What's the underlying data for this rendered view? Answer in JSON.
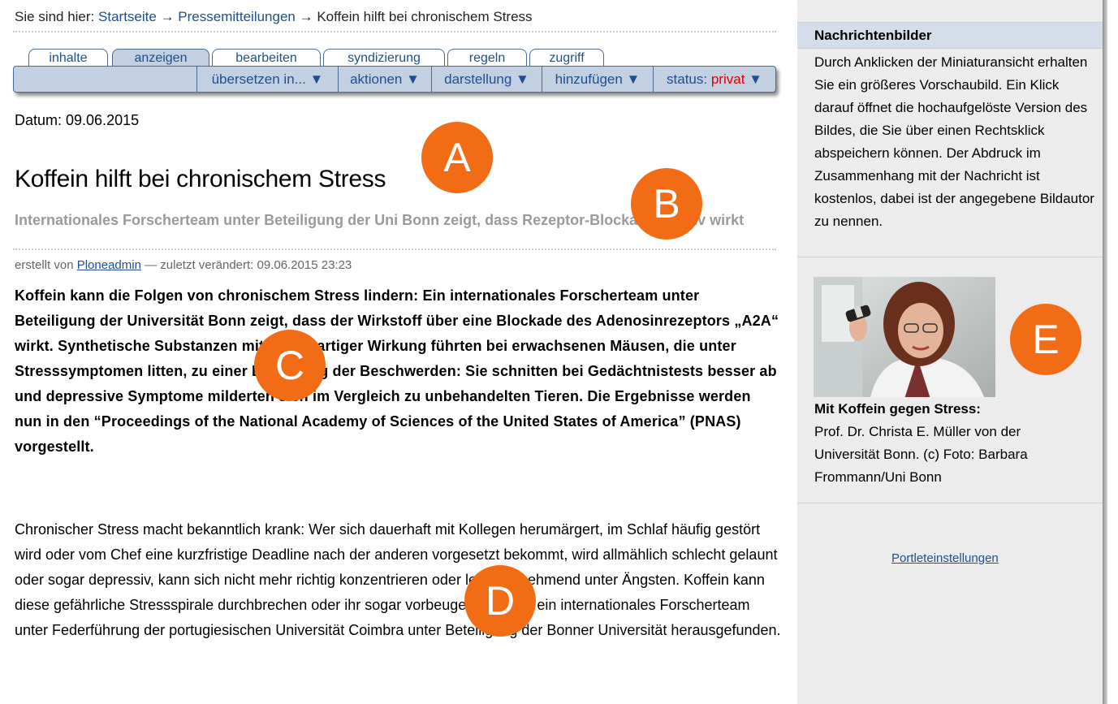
{
  "breadcrumb": {
    "prefix": "Sie sind hier:",
    "items": [
      "Startseite",
      "Pressemitteilungen",
      "Koffein hilft bei chronischem Stress"
    ],
    "separator": "→"
  },
  "tabs": [
    "inhalte",
    "anzeigen",
    "bearbeiten",
    "syndizierung",
    "regeln",
    "zugriff"
  ],
  "active_tab": "anzeigen",
  "actions": {
    "translate": "übersetzen in... ▼",
    "actions": "aktionen ▼",
    "display": "darstellung ▼",
    "add": "hinzufügen ▼",
    "status_label": "status:",
    "status_value": "privat",
    "status_arrow": "▼"
  },
  "article": {
    "date": "Datum: 09.06.2015",
    "title": "Koffein hilft bei chronischem Stress",
    "subtitle": "Internationales Forscherteam unter Beteiligung der Uni Bonn zeigt, dass Rezeptor-Blockade positiv wirkt",
    "byline_prefix": "erstellt von",
    "author": "Ploneadmin",
    "byline_suffix": "— zuletzt verändert: 09.06.2015 23:23",
    "lead": "Koffein kann die Folgen von chronischem Stress lindern: Ein internationales Forscherteam unter Beteiligung der Universität Bonn zeigt, dass der Wirkstoff über eine Blockade des Adenosinrezeptors „A2A“ wirkt. Synthetische Substanzen mit koffeinartiger Wirkung führten bei erwachsenen Mäusen, die unter Stresssymptomen litten, zu einer Besserung der Beschwerden: Sie schnitten bei Gedächtnistests besser ab und depressive Symptome milderten sich im Vergleich zu unbehandelten Tieren. Die Ergebnisse werden nun in den “Proceedings of the National Academy of Sciences of the United States of America” (PNAS) vorgestellt.",
    "body": "Chronischer Stress macht bekanntlich krank: Wer sich dauerhaft mit Kollegen herumärgert, im Schlaf häufig gestört wird oder vom Chef eine kurzfristige Deadline nach der anderen vorgesetzt bekommt, wird allmählich schlecht gelaunt oder sogar depressiv, kann sich nicht mehr richtig konzentrieren oder leidet zunehmend unter Ängsten. Koffein kann diese gefährliche Stressspirale durchbrechen oder ihr sogar vorbeugen. Das hat ein internationales Forscherteam unter Federführung der portugiesischen Universität Coimbra unter Beteiligung der Bonner Universität herausgefunden."
  },
  "sidebar": {
    "heading": "Nachrichtenbilder",
    "text": "Durch Anklicken der Miniaturansicht erhalten Sie ein größeres Vorschaubild. Ein Klick darauf öffnet die hochaufgelöste Version des Bildes, die Sie über einen Rechtsklick abspeichern können. Der Abdruck im Zusammenhang mit der Nachricht ist kostenlos, dabei ist der angegebene Bildautor zu nennen.",
    "caption_title": "Mit Koffein gegen Stress:",
    "caption": "Prof. Dr. Christa E. Müller von der Universität Bonn. (c) Foto: Barbara Frommann/Uni Bonn",
    "settings_link": "Portleteinstellungen"
  },
  "annotations": [
    "A",
    "B",
    "C",
    "D",
    "E"
  ],
  "colors": {
    "link": "#1f4f8c",
    "tab_active": "#c3d0e2",
    "status_private": "#e00000",
    "badge": "#f26b15",
    "sidebar_bg": "#ececec"
  }
}
